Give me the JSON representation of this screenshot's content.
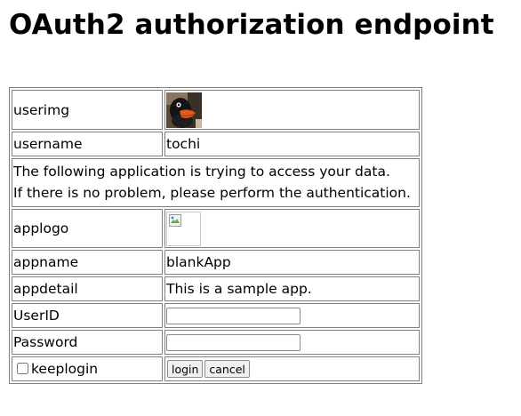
{
  "page": {
    "title": "OAuth2 authorization endpoint"
  },
  "form": {
    "userimg_label": "userimg",
    "username_label": "username",
    "username_value": "tochi",
    "message_line1": "The following application is trying to access your data.",
    "message_line2": "If there is no problem, please perform the authentication.",
    "applogo_label": "applogo",
    "appname_label": "appname",
    "appname_value": "blankApp",
    "appdetail_label": "appdetail",
    "appdetail_value": "This is a sample app.",
    "userid_label": "UserID",
    "userid_value": "",
    "password_label": "Password",
    "password_value": "",
    "keeplogin_label": "keeplogin",
    "keeplogin_checked": false,
    "login_button": "login",
    "cancel_button": "cancel"
  },
  "icons": {
    "user_image": "user-avatar-image",
    "app_logo": "broken-image-icon"
  }
}
